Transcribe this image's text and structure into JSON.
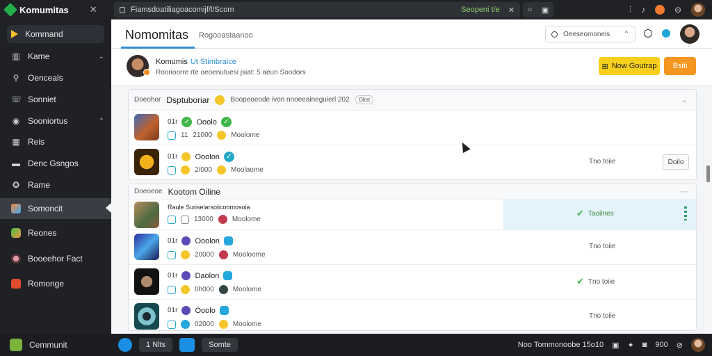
{
  "topbar": {
    "brand": "Komumitas",
    "url": "Fiamsdoatiliagoacomijf/l/Scom",
    "status": "Seopeni t/e",
    "pill_label": "O"
  },
  "sidebar": {
    "items": [
      {
        "label": "Kommand",
        "icon": "play-icon"
      },
      {
        "label": "Kame",
        "icon": "home-icon"
      },
      {
        "label": "Oenceals",
        "icon": "search-icon"
      },
      {
        "label": "Sonniet",
        "icon": "phone-icon"
      },
      {
        "label": "Sooniortus",
        "icon": "pin-icon"
      },
      {
        "label": "Reis",
        "icon": "calendar-icon"
      },
      {
        "label": "Denc Gsngos",
        "icon": "bookmark-icon"
      },
      {
        "label": "Rame",
        "icon": "star-icon"
      },
      {
        "label": "Somoncit",
        "icon": "grid-icon"
      },
      {
        "label": "Reones",
        "icon": "game-icon"
      },
      {
        "label": "Booeehor Fact",
        "icon": "avatar-icon"
      },
      {
        "label": "Romonge",
        "icon": "app-icon"
      }
    ],
    "footer_label": "Cemmunit"
  },
  "header": {
    "title": "Nomomitas",
    "subtitle": "Rogooastaanoo",
    "search_value": "Oeeseomoneis"
  },
  "profile": {
    "name": "Komumis",
    "tag": "Ut Stimbraice",
    "description": "Roorioorre rte oeoenutuesi jsiat: 5 aeun Soodors",
    "primary_button": "Now Goutrap",
    "secondary_button": "Bsiti"
  },
  "sections": [
    {
      "title": "Dsptuboriar",
      "prefix": "Doeohor",
      "meta": "Boopeoeode ivon nnoeeaineguierl 202",
      "pill": "Okst",
      "rows": [
        {
          "num": "01r",
          "name": "Ooolo",
          "count_a": "11",
          "count_b": "21000",
          "tag": "Moolome",
          "status": "",
          "action": ""
        },
        {
          "num": "01r",
          "name": "Ooolon",
          "count_a": "",
          "count_b": "2/000",
          "tag": "Moolaome",
          "status": "Tno toiie",
          "action": "Doilo"
        }
      ]
    },
    {
      "title": "Kootom Oiline",
      "prefix": "Doeoeoe",
      "meta": "",
      "pill": "",
      "rows": [
        {
          "num": "",
          "name": "Raule Suriselarsoiicoomosoia",
          "count_a": "",
          "count_b": "13000",
          "tag": "Moolome",
          "status": "Taoilnes",
          "action": ""
        },
        {
          "num": "01r",
          "name": "Ooolon",
          "count_a": "",
          "count_b": "20000",
          "tag": "Mooloome",
          "status": "Tno toiie",
          "action": ""
        },
        {
          "num": "01r",
          "name": "Daolon",
          "count_a": "",
          "count_b": "0h000",
          "tag": "Moolome",
          "status": "Tno toiie",
          "action": ""
        },
        {
          "num": "01r",
          "name": "Ooolo",
          "count_a": "",
          "count_b": "02000",
          "tag": "Moolome",
          "status": "Tno toiie",
          "action": ""
        }
      ]
    }
  ],
  "taskbar": {
    "btn1": "1 Nlts",
    "btn2": "Somte",
    "right_text": "Noo Tommonoobe 15o10",
    "right_num": "900"
  },
  "colors": {
    "accent": "#2d8fd5",
    "yellow": "#f8d01c",
    "orange": "#f59620",
    "green": "#3fb54a"
  }
}
